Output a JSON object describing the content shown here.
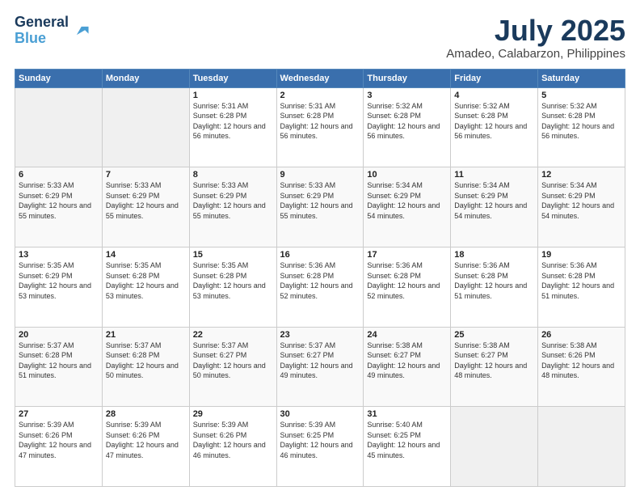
{
  "header": {
    "logo_line1": "General",
    "logo_line2": "Blue",
    "title": "July 2025",
    "subtitle": "Amadeo, Calabarzon, Philippines"
  },
  "weekdays": [
    "Sunday",
    "Monday",
    "Tuesday",
    "Wednesday",
    "Thursday",
    "Friday",
    "Saturday"
  ],
  "weeks": [
    [
      {
        "day": "",
        "info": ""
      },
      {
        "day": "",
        "info": ""
      },
      {
        "day": "1",
        "info": "Sunrise: 5:31 AM\nSunset: 6:28 PM\nDaylight: 12 hours and 56 minutes."
      },
      {
        "day": "2",
        "info": "Sunrise: 5:31 AM\nSunset: 6:28 PM\nDaylight: 12 hours and 56 minutes."
      },
      {
        "day": "3",
        "info": "Sunrise: 5:32 AM\nSunset: 6:28 PM\nDaylight: 12 hours and 56 minutes."
      },
      {
        "day": "4",
        "info": "Sunrise: 5:32 AM\nSunset: 6:28 PM\nDaylight: 12 hours and 56 minutes."
      },
      {
        "day": "5",
        "info": "Sunrise: 5:32 AM\nSunset: 6:28 PM\nDaylight: 12 hours and 56 minutes."
      }
    ],
    [
      {
        "day": "6",
        "info": "Sunrise: 5:33 AM\nSunset: 6:29 PM\nDaylight: 12 hours and 55 minutes."
      },
      {
        "day": "7",
        "info": "Sunrise: 5:33 AM\nSunset: 6:29 PM\nDaylight: 12 hours and 55 minutes."
      },
      {
        "day": "8",
        "info": "Sunrise: 5:33 AM\nSunset: 6:29 PM\nDaylight: 12 hours and 55 minutes."
      },
      {
        "day": "9",
        "info": "Sunrise: 5:33 AM\nSunset: 6:29 PM\nDaylight: 12 hours and 55 minutes."
      },
      {
        "day": "10",
        "info": "Sunrise: 5:34 AM\nSunset: 6:29 PM\nDaylight: 12 hours and 54 minutes."
      },
      {
        "day": "11",
        "info": "Sunrise: 5:34 AM\nSunset: 6:29 PM\nDaylight: 12 hours and 54 minutes."
      },
      {
        "day": "12",
        "info": "Sunrise: 5:34 AM\nSunset: 6:29 PM\nDaylight: 12 hours and 54 minutes."
      }
    ],
    [
      {
        "day": "13",
        "info": "Sunrise: 5:35 AM\nSunset: 6:29 PM\nDaylight: 12 hours and 53 minutes."
      },
      {
        "day": "14",
        "info": "Sunrise: 5:35 AM\nSunset: 6:28 PM\nDaylight: 12 hours and 53 minutes."
      },
      {
        "day": "15",
        "info": "Sunrise: 5:35 AM\nSunset: 6:28 PM\nDaylight: 12 hours and 53 minutes."
      },
      {
        "day": "16",
        "info": "Sunrise: 5:36 AM\nSunset: 6:28 PM\nDaylight: 12 hours and 52 minutes."
      },
      {
        "day": "17",
        "info": "Sunrise: 5:36 AM\nSunset: 6:28 PM\nDaylight: 12 hours and 52 minutes."
      },
      {
        "day": "18",
        "info": "Sunrise: 5:36 AM\nSunset: 6:28 PM\nDaylight: 12 hours and 51 minutes."
      },
      {
        "day": "19",
        "info": "Sunrise: 5:36 AM\nSunset: 6:28 PM\nDaylight: 12 hours and 51 minutes."
      }
    ],
    [
      {
        "day": "20",
        "info": "Sunrise: 5:37 AM\nSunset: 6:28 PM\nDaylight: 12 hours and 51 minutes."
      },
      {
        "day": "21",
        "info": "Sunrise: 5:37 AM\nSunset: 6:28 PM\nDaylight: 12 hours and 50 minutes."
      },
      {
        "day": "22",
        "info": "Sunrise: 5:37 AM\nSunset: 6:27 PM\nDaylight: 12 hours and 50 minutes."
      },
      {
        "day": "23",
        "info": "Sunrise: 5:37 AM\nSunset: 6:27 PM\nDaylight: 12 hours and 49 minutes."
      },
      {
        "day": "24",
        "info": "Sunrise: 5:38 AM\nSunset: 6:27 PM\nDaylight: 12 hours and 49 minutes."
      },
      {
        "day": "25",
        "info": "Sunrise: 5:38 AM\nSunset: 6:27 PM\nDaylight: 12 hours and 48 minutes."
      },
      {
        "day": "26",
        "info": "Sunrise: 5:38 AM\nSunset: 6:26 PM\nDaylight: 12 hours and 48 minutes."
      }
    ],
    [
      {
        "day": "27",
        "info": "Sunrise: 5:39 AM\nSunset: 6:26 PM\nDaylight: 12 hours and 47 minutes."
      },
      {
        "day": "28",
        "info": "Sunrise: 5:39 AM\nSunset: 6:26 PM\nDaylight: 12 hours and 47 minutes."
      },
      {
        "day": "29",
        "info": "Sunrise: 5:39 AM\nSunset: 6:26 PM\nDaylight: 12 hours and 46 minutes."
      },
      {
        "day": "30",
        "info": "Sunrise: 5:39 AM\nSunset: 6:25 PM\nDaylight: 12 hours and 46 minutes."
      },
      {
        "day": "31",
        "info": "Sunrise: 5:40 AM\nSunset: 6:25 PM\nDaylight: 12 hours and 45 minutes."
      },
      {
        "day": "",
        "info": ""
      },
      {
        "day": "",
        "info": ""
      }
    ]
  ]
}
